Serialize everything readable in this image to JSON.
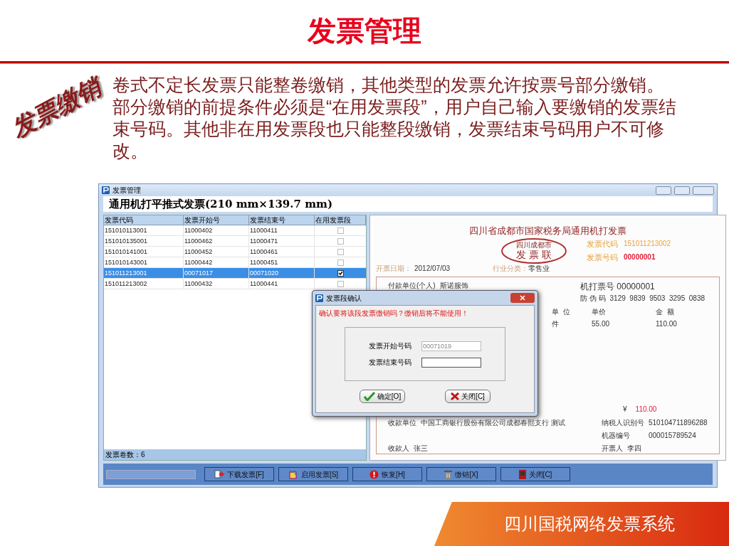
{
  "slide": {
    "title": "发票管理",
    "side_label": "发票缴销",
    "paragraphs": [
      "卷式不定长发票只能整卷缴销，其他类型的发票允许按票号部分缴销。",
      "部分缴销的前提条件必须是“在用发票段”，用户自己输入要缴销的发票结束号码。其他非在用发票段也只能整段缴销，发票结束号码用户不可修改。"
    ],
    "footer": "四川国税网络发票系统"
  },
  "window": {
    "title": "发票管理",
    "heading": "通用机打平推式发票(210 mm×139.7 mm)",
    "table": {
      "columns": [
        "发票代码",
        "发票开始号",
        "发票结束号",
        "在用发票段"
      ],
      "rows": [
        {
          "cells": [
            "151010113001",
            "11000402",
            "11000411"
          ],
          "checked": false,
          "selected": false
        },
        {
          "cells": [
            "151010135001",
            "11000462",
            "11000471"
          ],
          "checked": false,
          "selected": false
        },
        {
          "cells": [
            "151010141001",
            "11000452",
            "11000461"
          ],
          "checked": false,
          "selected": false
        },
        {
          "cells": [
            "151010143001",
            "11000442",
            "11000451"
          ],
          "checked": false,
          "selected": false
        },
        {
          "cells": [
            "151011213001",
            "00071017",
            "00071020"
          ],
          "checked": true,
          "selected": true
        },
        {
          "cells": [
            "151011213002",
            "11000432",
            "11000441"
          ],
          "checked": false,
          "selected": false
        }
      ]
    },
    "status": "发票卷数：6",
    "invoice": {
      "title": "四川省成都市国家税务局通用机打发票",
      "stamp": "四川成都市",
      "copy": "发 票 联",
      "code_label": "发票代码",
      "code": "151011213002",
      "number_label": "发票号码",
      "number": "00000001",
      "date_label": "开票日期：",
      "date": "2012/07/03",
      "industry_label": "行业分类：",
      "industry": "零售业",
      "payer_label": "付款单位(个人)",
      "payer": "斯诺服饰",
      "machine_no": "机打票号 00000001",
      "anti_fake_label": "防 伪 码",
      "anti_fake": "3129  9839  9503  3295  0838",
      "item_heads": [
        "单  位",
        "单价",
        "金  额"
      ],
      "item_row": [
        "件",
        "55.00",
        "110.00"
      ],
      "total_symbol": "¥",
      "total": "110.00",
      "payee_unit_label": "收款单位",
      "payee_unit": "中国工商银行股份有限公司成都春熙支行 测试",
      "tax_id_label": "纳税人识别号",
      "tax_id": "510104711896288",
      "machine_label": "机器编号",
      "machine": "000015789524",
      "payee_label": "收款人",
      "payee": "张三",
      "drawer_label": "开票人",
      "drawer": "李四"
    },
    "buttons": [
      {
        "label": "下载发票[F]",
        "kind": "download"
      },
      {
        "label": "启用发票[S]",
        "kind": "enable"
      },
      {
        "label": "恢复[H]",
        "kind": "restore"
      },
      {
        "label": "缴销[X]",
        "kind": "cancel"
      },
      {
        "label": "关闭[C]",
        "kind": "close"
      }
    ]
  },
  "dialog": {
    "title": "发票段确认",
    "warning": "确认要将该段发票缴销吗？缴销后将不能使用！",
    "fields": [
      {
        "label": "发票开始号码",
        "value": "00071019",
        "disabled": true
      },
      {
        "label": "发票结束号码",
        "disabled": false
      }
    ],
    "buttons": [
      {
        "label": "确定[O]",
        "kind": "ok"
      },
      {
        "label": "关闭[C]",
        "kind": "close"
      }
    ]
  }
}
